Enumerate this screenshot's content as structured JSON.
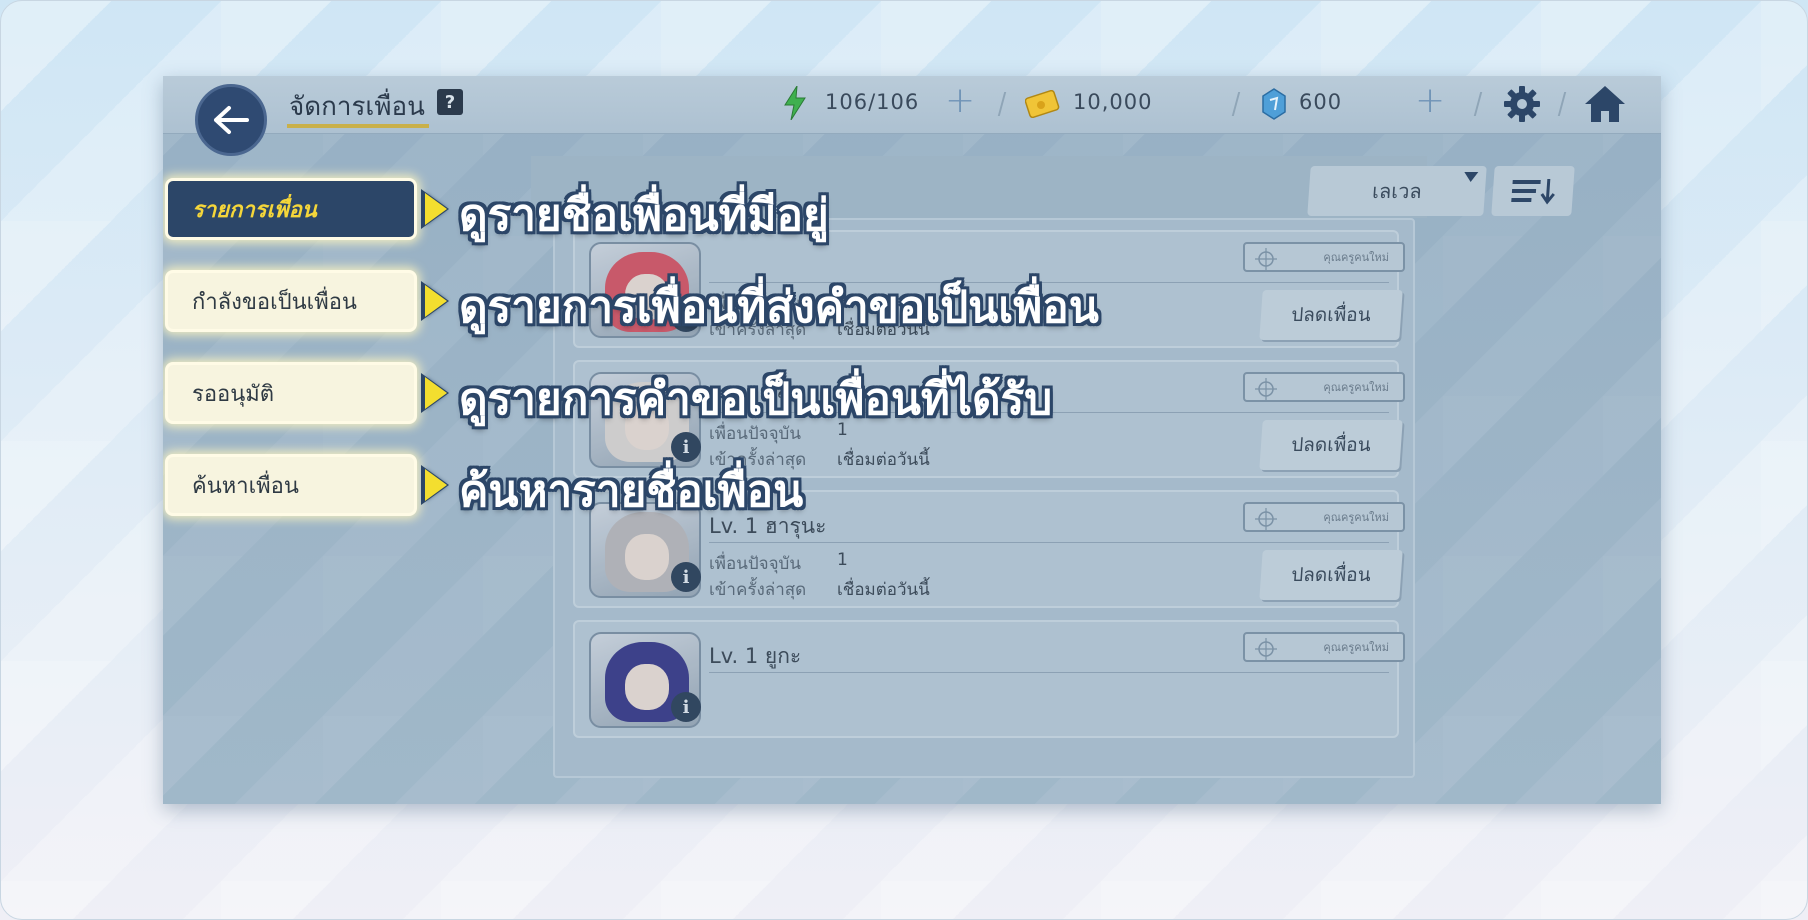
{
  "header": {
    "title": "จัดการเพื่อน",
    "help_label": "?",
    "stamina": "106/106",
    "gold": "10,000",
    "gems": "600"
  },
  "tabs": [
    {
      "label": "รายการเพื่อน",
      "active": true
    },
    {
      "label": "กำลังขอเป็นเพื่อน",
      "active": false
    },
    {
      "label": "รออนุมัติ",
      "active": false
    },
    {
      "label": "ค้นหาเพื่อน",
      "active": false
    }
  ],
  "annotations": [
    "ดูรายชื่อเพื่อนที่มีอยู่",
    "ดูรายการเพื่อนที่ส่งคำขอเป็นเพื่อน",
    "ดูรายการคำขอเป็นเพื่อนที่ได้รับ",
    "ค้นหารายชื่อเพื่อน"
  ],
  "sort": {
    "dropdown_value": "เลเวล"
  },
  "friend_card_labels": {
    "current_friends": "เพื่อนปัจจุบัน",
    "last_login": "เข้าครั้งล่าสุด",
    "status_chip": "คุณครูคนใหม่",
    "unfriend": "ปลดเพื่อน"
  },
  "friends": [
    {
      "lv_name": "",
      "count": "1",
      "last_login": "เชื่อมต่อวันนี้",
      "hair": "#d45a6a"
    },
    {
      "lv_name": "Lv. 1 อิซุมิ",
      "count": "1",
      "last_login": "เชื่อมต่อวันนี้",
      "hair": "#d9d6d4"
    },
    {
      "lv_name": "Lv. 1 ฮารุนะ",
      "count": "1",
      "last_login": "เชื่อมต่อวันนี้",
      "hair": "#b9b9bd"
    },
    {
      "lv_name": "Lv. 1 ยูกะ",
      "count": "",
      "last_login": "",
      "hair": "#3d3f8c"
    }
  ],
  "colors": {
    "accent_yellow": "#f3de2f",
    "navy": "#2c4668",
    "annotation_text": "#ffffff"
  },
  "icons": [
    "back-arrow-icon",
    "help-icon",
    "stamina-bolt-icon",
    "gold-card-icon",
    "gem-icon",
    "plus-icon",
    "gear-icon",
    "home-icon",
    "sort-order-icon",
    "info-icon",
    "target-icon"
  ]
}
